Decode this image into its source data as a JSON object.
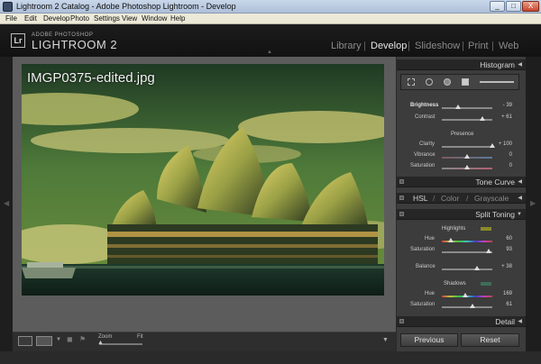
{
  "window": {
    "title": "Lightroom 2 Catalog - Adobe Photoshop Lightroom - Develop",
    "controls": {
      "minimize": "_",
      "maximize": "□",
      "close": "X"
    }
  },
  "menu": [
    "File",
    "Edit",
    "Develop",
    "Photo",
    "Settings",
    "View",
    "Window",
    "Help"
  ],
  "brand": {
    "logo": "Lr",
    "line1": "ADOBE PHOTOSHOP",
    "line2": "LIGHTROOM 2"
  },
  "modules": [
    "Library",
    "Develop",
    "Slideshow",
    "Print",
    "Web"
  ],
  "active_module": "Develop",
  "photo": {
    "filename": "IMGP0375-edited.jpg"
  },
  "toolbar": {
    "zoom_label": "Zoom",
    "fit_label": "Fit"
  },
  "panel": {
    "histogram_title": "Histogram",
    "basic": {
      "brightness": {
        "label": "Brightness",
        "value": "- 39",
        "level": 0.32
      },
      "contrast": {
        "label": "Contrast",
        "value": "+ 61",
        "level": 0.8
      },
      "presence_title": "Presence",
      "clarity": {
        "label": "Clarity",
        "value": "+ 100",
        "level": 1.0
      },
      "vibrance": {
        "label": "Vibrance",
        "value": "0",
        "level": 0.5
      },
      "saturation": {
        "label": "Saturation",
        "value": "0",
        "level": 0.5
      }
    },
    "tone_curve_title": "Tone Curve",
    "hsl_tabs": [
      "HSL",
      "Color",
      "Grayscale"
    ],
    "split_toning": {
      "title": "Split Toning",
      "highlights_title": "Highlights",
      "highlights_color": "#8a8a2a",
      "hl_hue": {
        "label": "Hue",
        "value": "60",
        "level": 0.17
      },
      "hl_sat": {
        "label": "Saturation",
        "value": "93",
        "level": 0.93
      },
      "balance": {
        "label": "Balance",
        "value": "+ 38",
        "level": 0.69
      },
      "shadows_title": "Shadows",
      "shadows_color": "#3d6e5a",
      "sh_hue": {
        "label": "Hue",
        "value": "169",
        "level": 0.47
      },
      "sh_sat": {
        "label": "Saturation",
        "value": "61",
        "level": 0.61
      }
    },
    "detail_title": "Detail",
    "previous_label": "Previous",
    "reset_label": "Reset"
  }
}
